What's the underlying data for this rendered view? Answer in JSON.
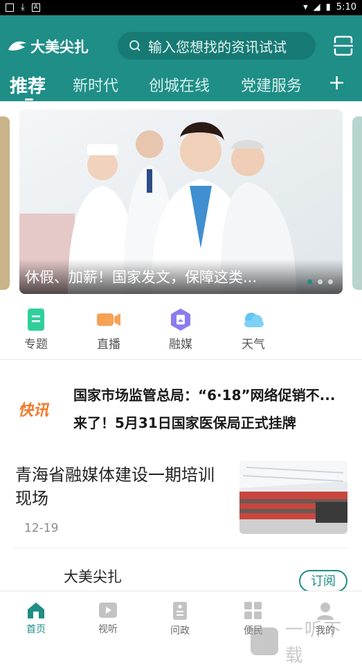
{
  "status_bar": {
    "time": "5:10"
  },
  "header": {
    "app_name": "大美尖扎",
    "search_placeholder": "输入您想找的资讯试试",
    "tabs": [
      {
        "label": "推荐",
        "active": true
      },
      {
        "label": "新时代"
      },
      {
        "label": "创城在线"
      },
      {
        "label": "党建服务"
      }
    ],
    "add_tab": "+"
  },
  "banner": {
    "caption": "休假、加薪！国家发文，保障这类...",
    "total_slides": 3,
    "current_slide": 1
  },
  "quick_links": [
    {
      "label": "专题",
      "icon": "topic-icon"
    },
    {
      "label": "直播",
      "icon": "live-video-icon"
    },
    {
      "label": "融媒",
      "icon": "media-badge-icon"
    },
    {
      "label": "天气",
      "icon": "weather-cloud-icon"
    }
  ],
  "flash_news": {
    "logo": "快讯",
    "items": [
      "国家市场监管总局：“6·18”网络促销不...",
      "来了！5月31日国家医保局正式挂牌"
    ]
  },
  "news_item": {
    "title": "青海省融媒体建设一期培训现场",
    "date": "12-19"
  },
  "subscription": {
    "name": "大美尖扎",
    "button": "订阅"
  },
  "bottom_nav": [
    {
      "label": "首页",
      "icon": "home-icon",
      "active": true
    },
    {
      "label": "视听",
      "icon": "video-play-icon"
    },
    {
      "label": "问政",
      "icon": "document-icon"
    },
    {
      "label": "便民",
      "icon": "grid-apps-icon"
    },
    {
      "label": "我的",
      "icon": "user-icon"
    }
  ],
  "watermark": "一听下载",
  "colors": {
    "brand": "#1e8e87",
    "flash": "#f07a2a"
  }
}
